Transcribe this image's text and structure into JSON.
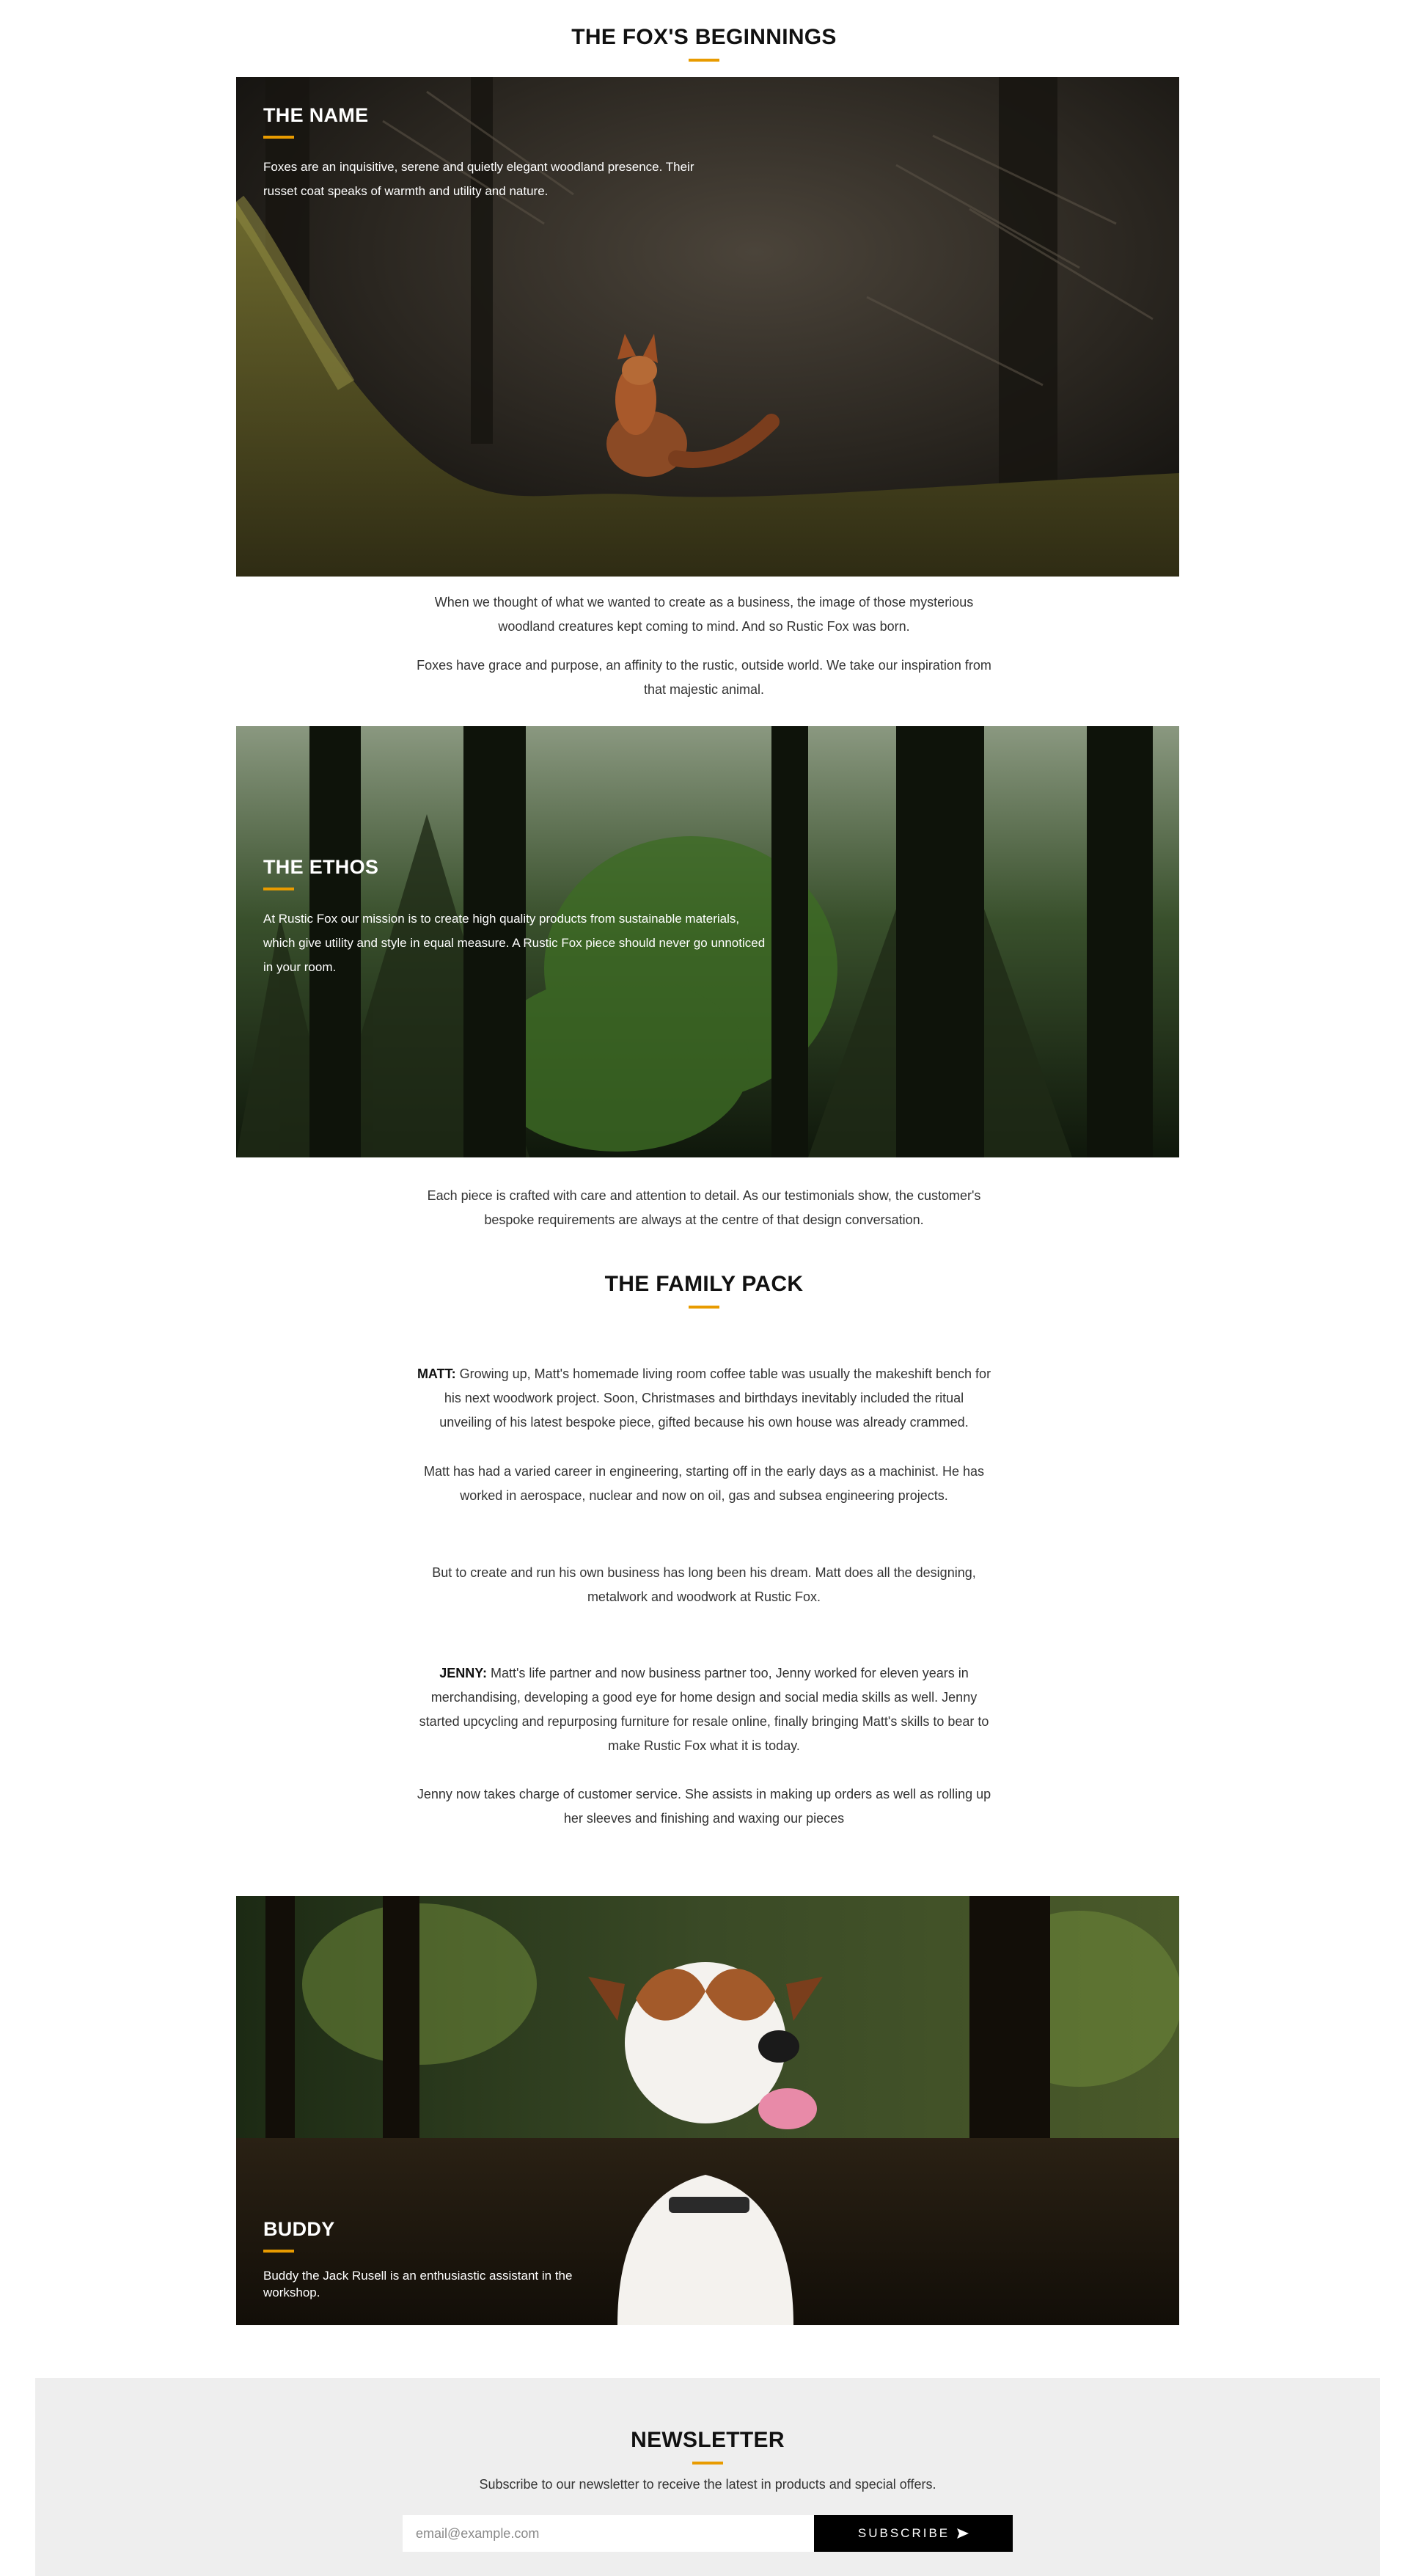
{
  "beginnings": {
    "heading": "THE FOX'S BEGINNINGS",
    "card": {
      "title": "THE NAME",
      "text_line1": "Foxes are an inquisitive, serene and quietly elegant woodland presence. Their",
      "text_line2": "russet coat speaks of warmth and utility and nature."
    },
    "para1_line1": "When we thought of what we wanted to create as a business, the image of those mysterious",
    "para1_line2": "woodland creatures kept coming to mind. And so Rustic Fox was born.",
    "para2_line1": "Foxes have grace and purpose, an affinity to the rustic, outside world. We take our inspiration from",
    "para2_line2": "that majestic animal."
  },
  "ethos": {
    "title": "THE ETHOS",
    "line1": "At Rustic Fox our mission is to create high quality products from sustainable materials,",
    "line2": "which give utility and style in equal measure. A Rustic Fox piece should never go unnoticed",
    "line3": "in your room.",
    "after_line1": "Each piece is crafted with care and attention to detail. As our testimonials show, the customer's",
    "after_line2": "bespoke requirements are always at the centre of that design conversation."
  },
  "family": {
    "heading": "THE FAMILY PACK",
    "matt_name": "MATT:",
    "matt_p1_line1": " Growing up, Matt's homemade living room coffee table was usually the makeshift bench for",
    "matt_p1_line2": "his next woodwork project. Soon, Christmases and birthdays inevitably included the ritual",
    "matt_p1_line3": "unveiling of his latest bespoke piece, gifted because his own house was already crammed.",
    "matt_p2_line1": "Matt has had a varied career in engineering, starting off in the early days as a machinist. He has",
    "matt_p2_line2": "worked in aerospace, nuclear and now on oil, gas and subsea engineering projects.",
    "matt_p3_line1": "But to create and run his own business has long been his dream. Matt does all the designing,",
    "matt_p3_line2": "metalwork and woodwork at Rustic Fox.",
    "jenny_name": "JENNY:",
    "jenny_p1_line1": " Matt's life partner and now business partner too, Jenny worked for eleven years in",
    "jenny_p1_line2": "merchandising, developing a good eye for home design and social media skills as well. Jenny",
    "jenny_p1_line3": "started upcycling and repurposing furniture for resale online, finally bringing Matt's skills to bear to",
    "jenny_p1_line4": "make Rustic Fox what it is today.",
    "jenny_p2_line1": "Jenny now takes charge of customer service. She assists in making up orders as well as rolling up",
    "jenny_p2_line2": "her sleeves and finishing and waxing our pieces"
  },
  "buddy": {
    "title": "BUDDY",
    "line1": "Buddy the Jack Rusell is an enthusiastic assistant in the",
    "line2": "workshop."
  },
  "newsletter": {
    "heading": "NEWSLETTER",
    "subtitle": "Subscribe to our newsletter to receive the latest in products and special offers.",
    "email_placeholder": "email@example.com",
    "button_label": "SUBSCRIBE",
    "button_icon": "send-arrow-icon"
  },
  "colors": {
    "accent": "#e89b00",
    "text": "#333333",
    "heading": "#111111",
    "newsletter_bg": "#eeeeee",
    "button_bg": "#000000"
  }
}
